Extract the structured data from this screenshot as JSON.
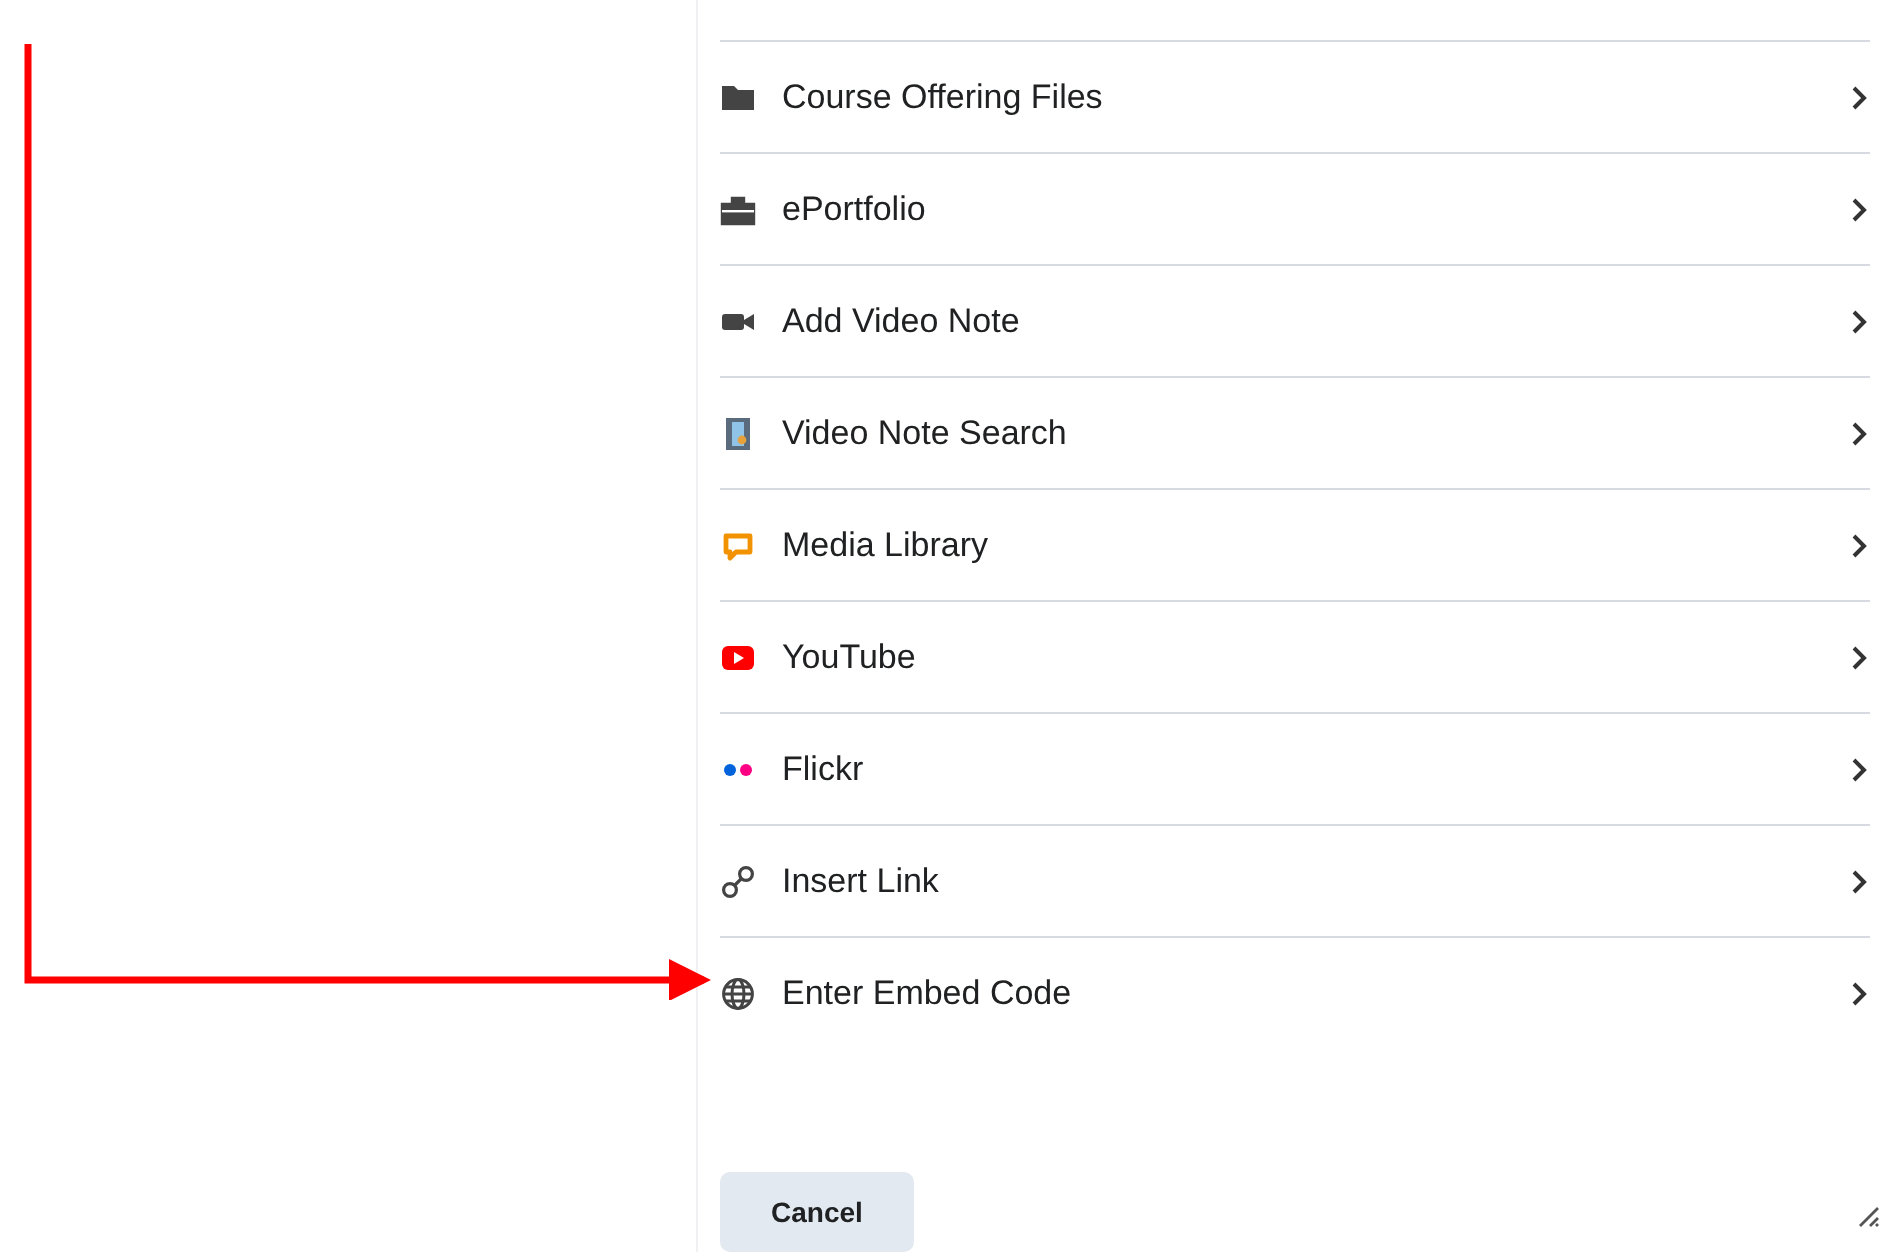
{
  "items": [
    {
      "kind": "folder",
      "label": "Course Offering Files"
    },
    {
      "kind": "briefcase",
      "label": "ePortfolio"
    },
    {
      "kind": "camera",
      "label": "Add Video Note"
    },
    {
      "kind": "film",
      "label": "Video Note Search"
    },
    {
      "kind": "chat",
      "label": "Media Library"
    },
    {
      "kind": "play",
      "label": "YouTube"
    },
    {
      "kind": "dots",
      "label": "Flickr"
    },
    {
      "kind": "link",
      "label": "Insert Link"
    },
    {
      "kind": "globe",
      "label": "Enter Embed Code"
    }
  ],
  "buttons": [
    "Cancel"
  ]
}
